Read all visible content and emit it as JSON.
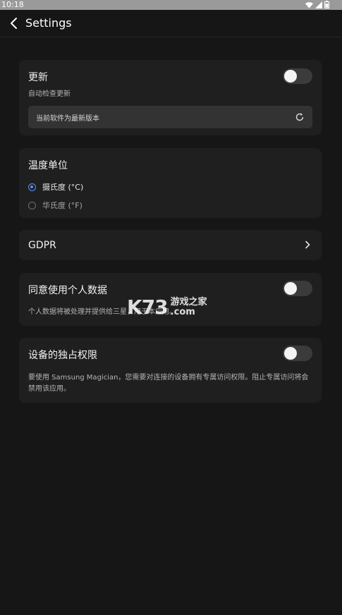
{
  "status_bar": {
    "time": "10:18",
    "icons": [
      "wifi-icon",
      "signal-icon",
      "battery-icon"
    ]
  },
  "app_bar": {
    "title": "Settings",
    "back_icon": "back-arrow-icon"
  },
  "update": {
    "title": "更新",
    "subtitle": "自动检查更新",
    "toggle_on": false,
    "version_status": "当前软件为最新版本",
    "refresh_icon": "refresh-icon"
  },
  "temperature": {
    "title": "温度单位",
    "options": [
      {
        "label": "摄氏度 (°C)",
        "selected": true
      },
      {
        "label": "华氏度 (°F)",
        "selected": false
      }
    ]
  },
  "gdpr": {
    "title": "GDPR",
    "chevron_icon": "chevron-right-icon"
  },
  "personal_data": {
    "title": "同意使用个人数据",
    "description": "个人数据将被处理并提供给三星，用于本应用。",
    "toggle_on": false
  },
  "device_access": {
    "title": "设备的独占权限",
    "description": "要使用 Samsung Magician，您需要对连接的设备拥有专属访问权限。阻止专属访问将会禁用该应用。",
    "toggle_on": false
  },
  "watermark": {
    "logo": "K73",
    "line1": "游戏之家",
    "line2": ".com"
  },
  "colors": {
    "background": "#161616",
    "card": "#1f1f1f",
    "accent": "#5b8ff0",
    "toggle_off": "#3b3b3b"
  }
}
